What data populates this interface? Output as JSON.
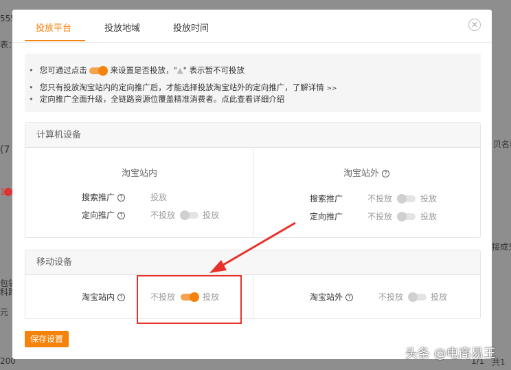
{
  "background": {
    "left_fragments": [
      "555",
      "表：4",
      "(7",
      "1",
      "包袋",
      "科跨",
      "元",
      "200"
    ],
    "right_fragments": [
      "贝名称",
      "接成交",
      "1/1",
      "共1"
    ]
  },
  "modal": {
    "tabs": [
      {
        "label": "投放平台",
        "active": true
      },
      {
        "label": "投放地域"
      },
      {
        "label": "投放时间"
      }
    ],
    "info": [
      {
        "pre": "您可通过点击",
        "post": "来设置是否投放，\"",
        "post2": "\" 表示暂不可投放"
      },
      {
        "text": "您只有投放淘宝站内的定向推广后，才能选择投放淘宝站外的定向推广，",
        "link": "了解详情",
        "arrow": ">>"
      },
      {
        "text": "定向推广全面升级，全链路资源位覆盖精准消费者。点此查看详细介绍"
      }
    ],
    "computer": {
      "title": "计算机设备",
      "inner": {
        "title": "淘宝站内",
        "rows": [
          {
            "label": "搜索推广",
            "value": "投放"
          },
          {
            "label": "定向推广",
            "off": "不投放",
            "on": "投放",
            "enabled": false
          }
        ]
      },
      "outer": {
        "title": "淘宝站外",
        "rows": [
          {
            "label": "搜索推广",
            "off": "不投放",
            "on": "投放",
            "enabled": false
          },
          {
            "label": "定向推广",
            "off": "不投放",
            "on": "投放",
            "enabled": false
          }
        ]
      }
    },
    "mobile": {
      "title": "移动设备",
      "inner": {
        "label": "淘宝站内",
        "off": "不投放",
        "on": "投放",
        "enabled": true
      },
      "outer": {
        "label": "淘宝站外",
        "off": "不投放",
        "on": "投放",
        "enabled": false
      }
    },
    "save_label": "保存设置"
  },
  "watermark": "头条 @电商易王",
  "colors": {
    "accent": "#f5820a",
    "highlight": "#e8312a"
  }
}
